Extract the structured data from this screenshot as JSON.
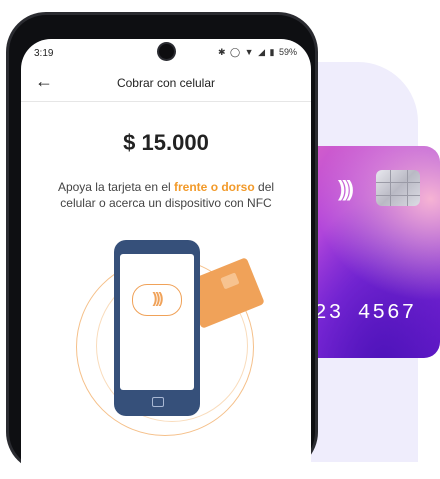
{
  "status_bar": {
    "time": "3:19",
    "icons": [
      "bluetooth-icon",
      "vibrate-icon",
      "wifi-icon",
      "signal-icon",
      "battery-icon"
    ],
    "battery": "59%"
  },
  "app_bar": {
    "back_icon": "arrow-left-icon",
    "title": "Cobrar con celular"
  },
  "amount": "$ 15.000",
  "instructions": {
    "before": "Apoya la tarjeta en el ",
    "highlight": "frente o dorso",
    "after": " del celular o acerca un dispositivo con NFC"
  },
  "card": {
    "number_partial": "23 4567"
  },
  "colors": {
    "accent": "#f29a2a",
    "illustration_phone": "#36507a",
    "background_panel": "#efedfc"
  }
}
